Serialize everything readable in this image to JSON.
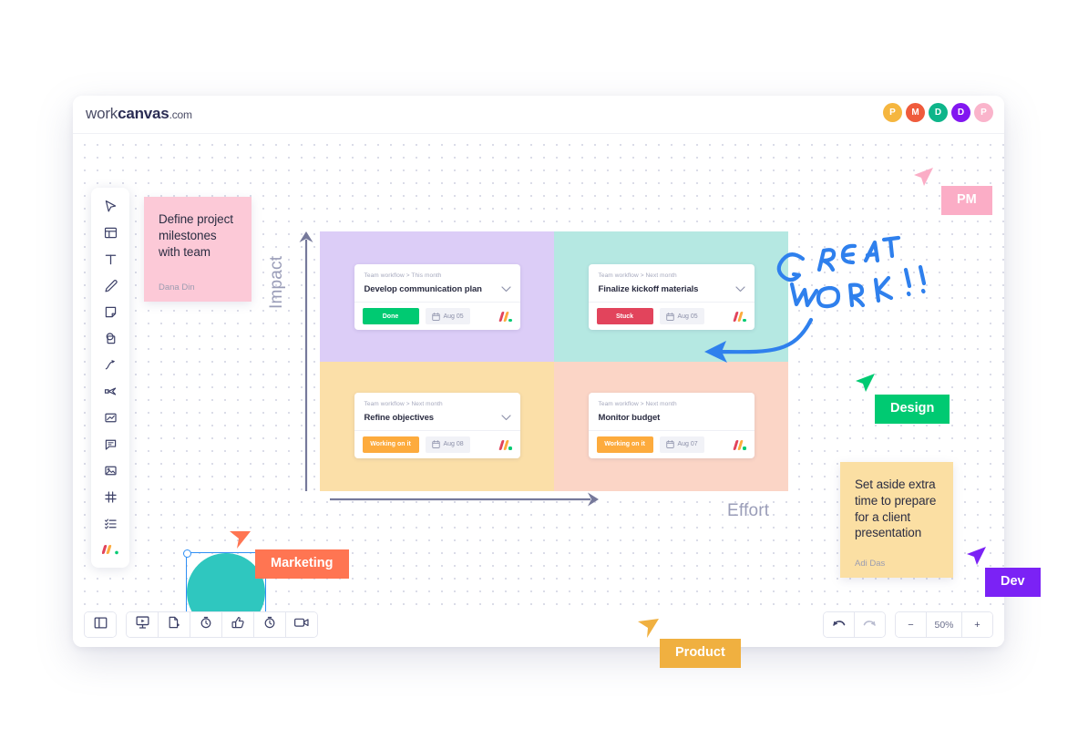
{
  "header": {
    "logo_work": "work",
    "logo_canvas": "canvas",
    "logo_domain": ".com",
    "avatars": [
      {
        "initial": "P",
        "color": "#f5b63f"
      },
      {
        "initial": "M",
        "color": "#ef5b3c"
      },
      {
        "initial": "D",
        "color": "#0eb58a"
      },
      {
        "initial": "D",
        "color": "#8217f0"
      },
      {
        "initial": "P",
        "color": "#fab4cb"
      }
    ]
  },
  "toolbar": {
    "items": [
      {
        "icon": "cursor-select-icon",
        "name": "tool-select"
      },
      {
        "icon": "frame-icon",
        "name": "tool-frame"
      },
      {
        "icon": "text-icon",
        "name": "tool-text"
      },
      {
        "icon": "pen-icon",
        "name": "tool-pen"
      },
      {
        "icon": "sticky-note-icon",
        "name": "tool-sticky-note"
      },
      {
        "icon": "shapes-icon",
        "name": "tool-shapes"
      },
      {
        "icon": "arrow-connector-icon",
        "name": "tool-connector"
      },
      {
        "icon": "scissors-icon",
        "name": "tool-cut"
      },
      {
        "icon": "embed-board-icon",
        "name": "tool-embed-board"
      },
      {
        "icon": "comment-icon",
        "name": "tool-comment"
      },
      {
        "icon": "image-icon",
        "name": "tool-image"
      },
      {
        "icon": "grid-icon",
        "name": "tool-grid"
      },
      {
        "icon": "checklist-icon",
        "name": "tool-checklist"
      },
      {
        "icon": "monday-logo-icon",
        "name": "tool-monday-apps"
      }
    ]
  },
  "bottom_left_bar": {
    "items": [
      {
        "icon": "sidebar-panel-icon",
        "name": "toggle-sidebar-button"
      },
      {
        "icon": "presentation-icon",
        "name": "present-button"
      },
      {
        "icon": "export-file-icon",
        "name": "export-button"
      },
      {
        "icon": "timer-icon",
        "name": "timer-button"
      },
      {
        "icon": "thumbs-up-icon",
        "name": "reactions-button"
      },
      {
        "icon": "stopwatch-icon",
        "name": "stopwatch-button"
      },
      {
        "icon": "video-camera-icon",
        "name": "video-button"
      }
    ]
  },
  "bottom_right_bar": {
    "undo_icon": "undo-icon",
    "redo_icon": "redo-icon",
    "zoom_out_label": "−",
    "zoom_level": "50%",
    "zoom_in_label": "+"
  },
  "axes": {
    "y_label": "Impact",
    "x_label": "Effort",
    "axis_color": "#76799b"
  },
  "matrix": {
    "quadrants": [
      {
        "name": "quadrant-high-impact-low-effort",
        "color": "#dccdf7"
      },
      {
        "name": "quadrant-high-impact-high-effort",
        "color": "#b5e8e2"
      },
      {
        "name": "quadrant-low-impact-low-effort",
        "color": "#fbdfa8"
      },
      {
        "name": "quadrant-low-impact-high-effort",
        "color": "#fbd5c6"
      }
    ],
    "cards": [
      {
        "breadcrumb": "Team workflow > This month",
        "title": "Develop communication plan",
        "status": "Done",
        "status_color": "#00ca72",
        "date": "Aug 05"
      },
      {
        "breadcrumb": "Team workflow > Next month",
        "title": "Finalize kickoff materials",
        "status": "Stuck",
        "status_color": "#e2445c",
        "date": "Aug 05"
      },
      {
        "breadcrumb": "Team workflow > Next month",
        "title": "Refine objectives",
        "status": "Working on it",
        "status_color": "#fdab3d",
        "date": "Aug 08"
      },
      {
        "breadcrumb": "Team workflow > Next month",
        "title": "Monitor budget",
        "status": "Working on it",
        "status_color": "#fdab3d",
        "date": "Aug 07"
      }
    ]
  },
  "sticky_notes": [
    {
      "name": "sticky-note-pink",
      "text": "Define project milestones with team",
      "author": "Dana Din",
      "color": "#fcc9d7"
    },
    {
      "name": "sticky-note-yellow",
      "text": "Set aside extra time to prepare for a client presentation",
      "author": "Adi Das",
      "color": "#fbdfa3"
    }
  ],
  "shape": {
    "name": "circle-shape",
    "color": "#2fc7bf",
    "selected": "true"
  },
  "annotation": {
    "line1": "GREAT",
    "line2": "WORK !!",
    "color": "#2f80ed"
  },
  "cursors": [
    {
      "label": "PM",
      "color": "#fbadc6",
      "name": "cursor-pm"
    },
    {
      "label": "Design",
      "color": "#00ca72",
      "name": "cursor-design"
    },
    {
      "label": "Dev",
      "color": "#7b22f5",
      "name": "cursor-dev"
    },
    {
      "label": "Marketing",
      "color": "#ff7552",
      "name": "cursor-marketing"
    },
    {
      "label": "Product",
      "color": "#f0b040",
      "name": "cursor-product"
    }
  ]
}
